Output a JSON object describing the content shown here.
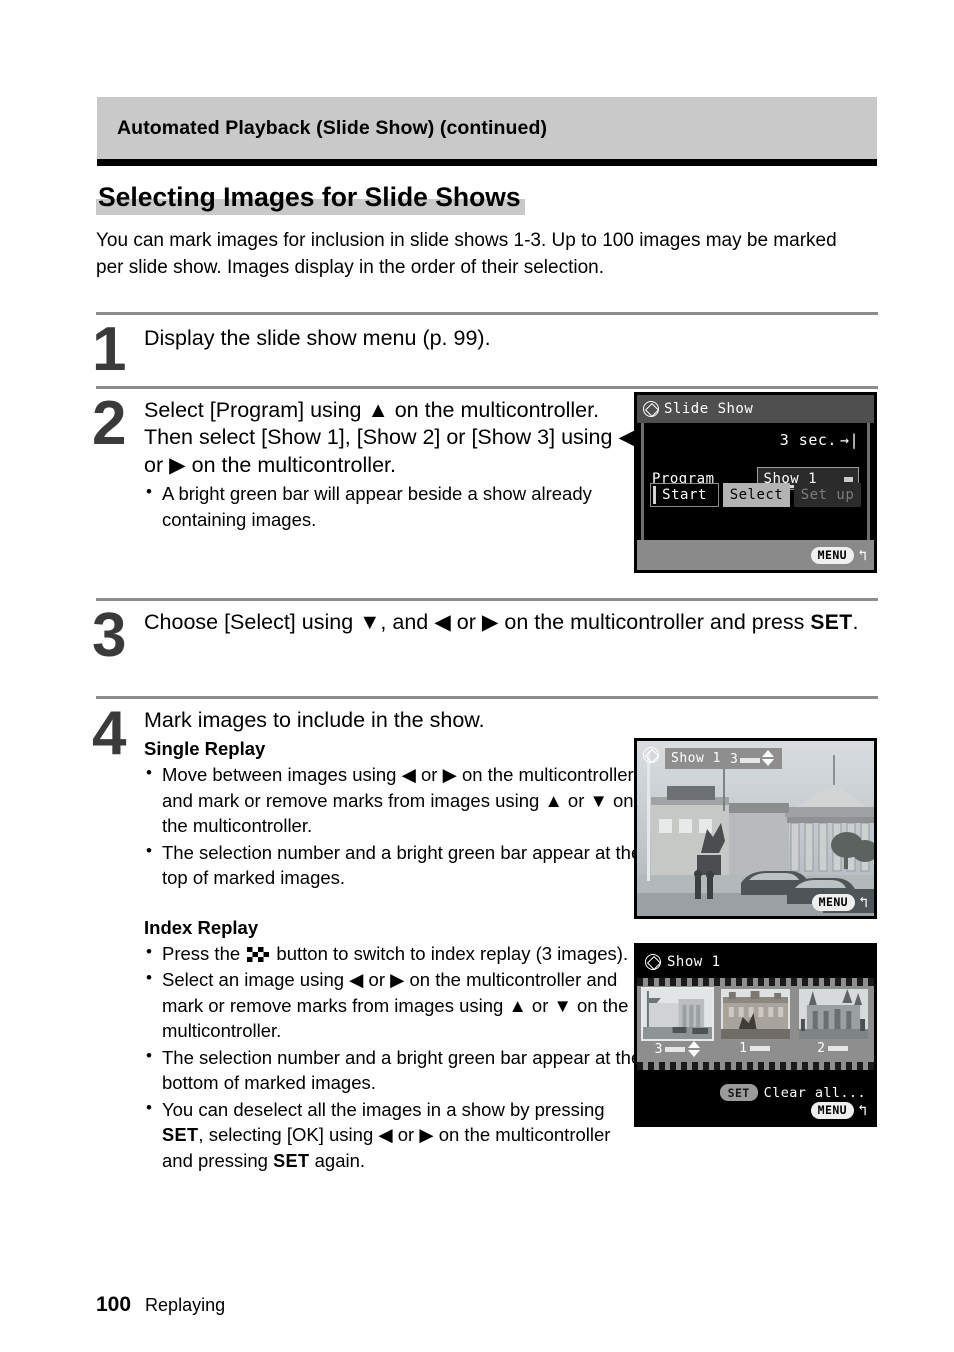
{
  "running_head": {
    "text": "Automated Playback (Slide Show) (continued)"
  },
  "section": {
    "title": "Selecting Images for Slide Shows",
    "intro": "You can mark images for inclusion in slide shows 1-3. Up to 100 images may be marked per slide show. Images display in the order of their selection."
  },
  "steps": [
    {
      "number": "1",
      "text": "Display the slide show menu (p. 99)."
    },
    {
      "number": "2",
      "text_part1": "Select [Program] using ",
      "arrow_up": "▲",
      "text_part2": " on the multicontroller. Then select [Show 1], [Show 2] or [Show 3] using ",
      "arrow_left": "◀",
      "text_part3": " or ",
      "arrow_right": "▶",
      "text_part4": " on the multicontroller.",
      "bullets": [
        "A bright green bar will appear beside a show already containing images."
      ]
    },
    {
      "number": "3",
      "text_part1": "Choose [Select] using ",
      "arrow_down": "▼",
      "text_part2": ", and ",
      "arrow_left": "◀",
      "text_part3": " or ",
      "arrow_right": "▶",
      "text_part4": " on the multicontroller and press ",
      "set_key": "SET",
      "text_part5": "."
    },
    {
      "number": "4",
      "text": "Mark images to include in the show.",
      "single_replay": {
        "heading": "Single Replay",
        "bullet1_a": "Move between images using ",
        "bullet1_left": "◀",
        "bullet1_b": " or ",
        "bullet1_right": "▶",
        "bullet1_c": " on the multicontroller and mark or remove marks from images using ",
        "bullet1_up": "▲",
        "bullet1_d": " or ",
        "bullet1_down": "▼",
        "bullet1_e": " on the multicontroller.",
        "bullet2": "The selection number and a bright green bar appear at the top of marked images."
      },
      "index_replay": {
        "heading": "Index Replay",
        "bullet1_a": "Press the ",
        "bullet1_icon": "index-button-icon",
        "bullet1_b": " button to switch to index replay (3 images).",
        "bullet2_a": "Select an image using ",
        "bullet2_left": "◀",
        "bullet2_b": " or ",
        "bullet2_right": "▶",
        "bullet2_c": " on the multicontroller and mark or remove marks from images using ",
        "bullet2_up": "▲",
        "bullet2_d": " or ",
        "bullet2_down": "▼",
        "bullet2_e": " on the multicontroller.",
        "bullet3": "The selection number and a bright green bar appear at the bottom of marked images.",
        "bullet4_a": "You can deselect all the images in a show by pressing ",
        "bullet4_set1": "SET",
        "bullet4_b": ", selecting [OK] using ",
        "bullet4_left": "◀",
        "bullet4_c": " or ",
        "bullet4_right": "▶",
        "bullet4_d": " on the multicontroller and pressing ",
        "bullet4_set2": "SET",
        "bullet4_e": " again."
      }
    }
  ],
  "lcd_menu": {
    "title": "Slide Show",
    "duration": "3 sec.",
    "duration_arrow": "→|",
    "program_label": "Program",
    "program_value": "Show 1",
    "buttons": [
      {
        "label": "Start",
        "state": "normal"
      },
      {
        "label": "Select",
        "state": "selected"
      },
      {
        "label": "Set up",
        "state": "disabled"
      }
    ],
    "menu_badge": "MENU",
    "back_arrow": "↰"
  },
  "lcd_single": {
    "show_label": "Show 1",
    "selection_number": "3",
    "menu_badge": "MENU",
    "back_arrow": "↰"
  },
  "lcd_index": {
    "title": "Show 1",
    "thumbnails": [
      {
        "label": "3",
        "marked": true,
        "active": true
      },
      {
        "label": "1",
        "marked": true,
        "active": false
      },
      {
        "label": "2",
        "marked": true,
        "active": false
      }
    ],
    "set_badge": "SET",
    "clear_all": "Clear all...",
    "menu_badge": "MENU",
    "back_arrow": "↰"
  },
  "footer": {
    "page_number": "100",
    "chapter": "Replaying"
  },
  "colors": {
    "header_gray": "#c9c9c9",
    "rule_gray": "#8d8d8d",
    "step_num": "#3a3a3a"
  }
}
